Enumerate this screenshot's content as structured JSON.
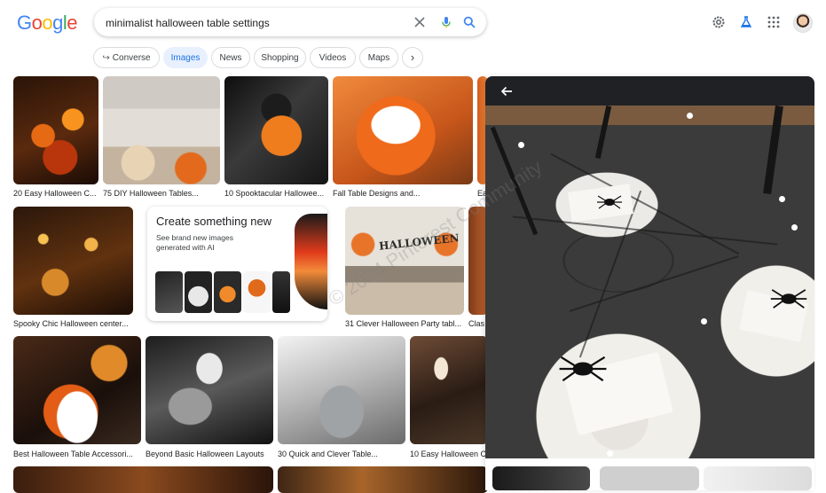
{
  "header": {
    "logo_text": "Google",
    "search_query": "minimalist halloween table settings"
  },
  "chips": [
    {
      "label": "Converse",
      "active": false
    },
    {
      "label": "Images",
      "active": true
    },
    {
      "label": "News",
      "active": false
    },
    {
      "label": "Shopping",
      "active": false
    },
    {
      "label": "Videos",
      "active": false
    },
    {
      "label": "Maps",
      "active": false
    }
  ],
  "results": {
    "row1": [
      "20 Easy Halloween C...",
      "75 DIY Halloween Tables...",
      "10 Spooktacular Hallowee...",
      "Fall Table Designs and...",
      "Ea"
    ],
    "row2": [
      "Spooky Chic Halloween center...",
      "31 Clever Halloween Party tabl...",
      "Clas"
    ],
    "row3": [
      "Best Halloween Table Accessori...",
      "Beyond Basic Halloween Layouts",
      "30 Quick and Clever Table...",
      "10 Easy Halloween C"
    ]
  },
  "create_card": {
    "title": "Create something new",
    "subtitle": "See brand new images generated with AI"
  },
  "thumbnail_text": {
    "halloween_banner": "HALLOWEEN"
  },
  "watermark": "© 2024 Pinterest Community",
  "colors": {
    "accent": "#1a73e8",
    "chip_active_bg": "#e8f0fe",
    "panel_bar": "#202124"
  }
}
